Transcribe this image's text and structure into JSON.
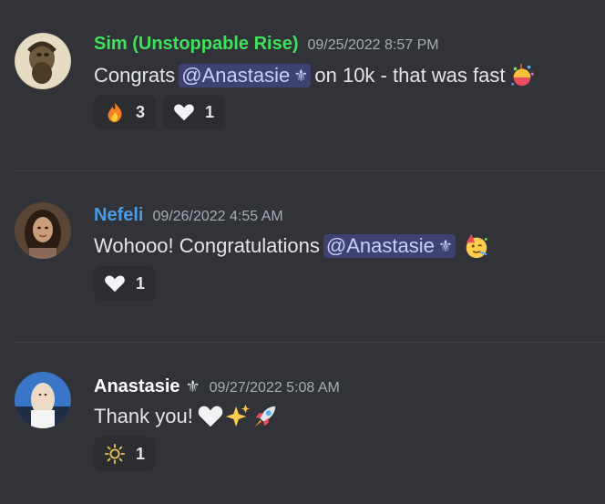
{
  "messages": [
    {
      "username": "Sim (Unstoppable Rise)",
      "username_color": "#3fe05a",
      "timestamp": "09/25/2022 8:57 PM",
      "text_before": "Congrats",
      "mention": "@Anastasie",
      "text_after": "on 10k - that was fast",
      "trailing_emoji": "confetti-ball-icon",
      "reactions": [
        {
          "emoji": "fire-icon",
          "count": "3"
        },
        {
          "emoji": "white-heart-icon",
          "count": "1"
        }
      ]
    },
    {
      "username": "Nefeli",
      "username_color": "#4a9ce8",
      "timestamp": "09/26/2022 4:55 AM",
      "text_before": "Wohooo! Congratulations",
      "mention": "@Anastasie",
      "text_after": "",
      "trailing_emoji": "partying-face-icon",
      "reactions": [
        {
          "emoji": "white-heart-icon",
          "count": "1"
        }
      ]
    },
    {
      "username": "Anastasie",
      "username_color": "#ffffff",
      "timestamp": "09/27/2022 5:08 AM",
      "text_before": "Thank you!",
      "mention": "",
      "text_after": "",
      "trailing_emoji": "white-heart-sparkles-rocket-icons",
      "reactions": [
        {
          "emoji": "sun-icon",
          "count": "1"
        }
      ]
    }
  ],
  "fleur_symbol": "⚜",
  "colors": {
    "background": "#313338",
    "reaction_bg": "#2b2d31",
    "mention_bg": "#3e4270",
    "mention_text": "#c9cdfb",
    "timestamp": "#a7abb2"
  }
}
